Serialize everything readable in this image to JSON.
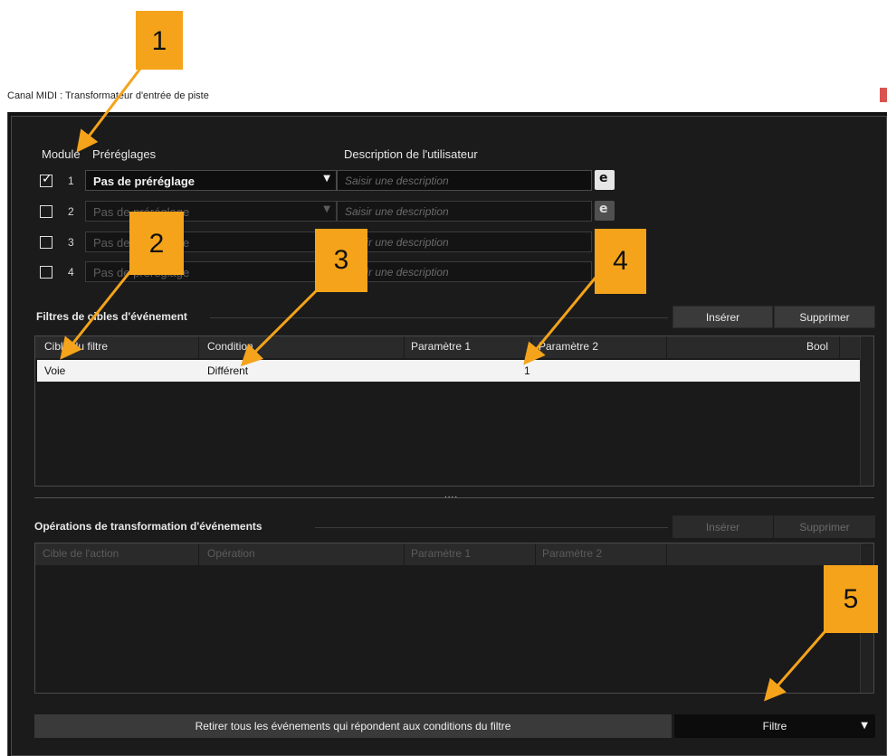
{
  "window": {
    "title": "Canal MIDI : Transformateur d'entrée de piste"
  },
  "modules": {
    "header_module": "Module",
    "header_presets": "Préréglages",
    "header_description": "Description de l'utilisateur",
    "rows": [
      {
        "number": "1",
        "checked": true,
        "preset": "Pas de préréglage",
        "description_placeholder": "Saisir une description"
      },
      {
        "number": "2",
        "checked": false,
        "preset": "Pas de préréglage",
        "description_placeholder": "Saisir une description"
      },
      {
        "number": "3",
        "checked": false,
        "preset": "Pas de préréglage",
        "description_placeholder": "Saisir une description"
      },
      {
        "number": "4",
        "checked": false,
        "preset": "Pas de préréglage",
        "description_placeholder": "Saisir une description"
      }
    ],
    "edit_glyph": "e"
  },
  "filters": {
    "title": "Filtres de cibles d'événement",
    "insert": "Insérer",
    "delete": "Supprimer",
    "columns": [
      "Cible du filtre",
      "Condition",
      "Paramètre 1",
      "Paramètre 2",
      "Bool"
    ],
    "rows": [
      {
        "target": "Voie",
        "condition": "Différent",
        "param1": "",
        "param2": "1",
        "bool": ""
      }
    ]
  },
  "splitter_grip": "....",
  "actions": {
    "title": "Opérations de transformation d'événements",
    "insert": "Insérer",
    "delete": "Supprimer",
    "columns": [
      "Cible de l'action",
      "Opération",
      "Paramètre 1",
      "Paramètre 2"
    ]
  },
  "function": {
    "description": "Retirer tous les événements qui répondent aux conditions du filtre",
    "selected": "Filtre"
  },
  "callouts": [
    "1",
    "2",
    "3",
    "4",
    "5"
  ],
  "colors": {
    "callout": "#f5a31a",
    "panel": "#1b1b1b",
    "table_row": "#f3f3f3"
  }
}
